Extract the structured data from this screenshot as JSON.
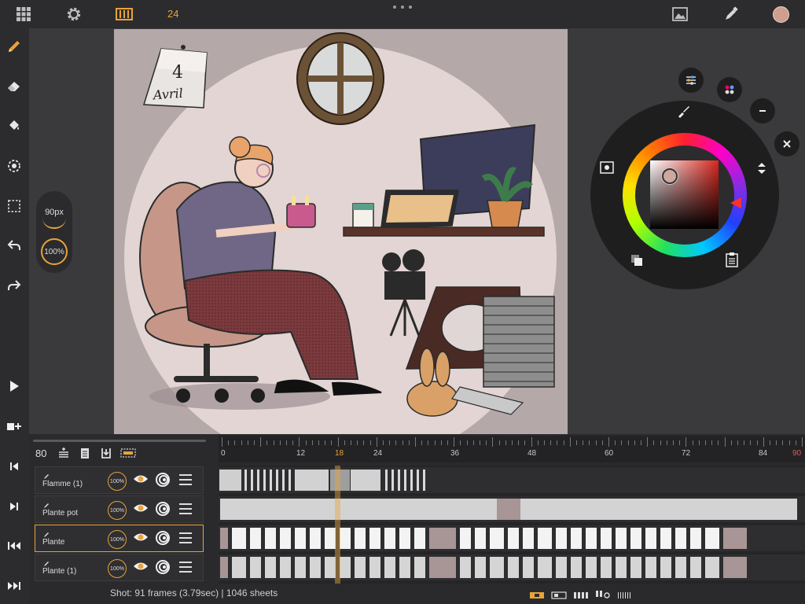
{
  "app": {
    "frame_rate": "24",
    "accent": "#e8a33b"
  },
  "topbar": {
    "icons": [
      "grid-icon",
      "settings-gear-icon",
      "film-strip-icon",
      "gallery-image-icon",
      "color-picker-pen-icon"
    ],
    "fps_label": "24",
    "avatar_color": "#cf9e8c"
  },
  "left_toolbar": {
    "tools": [
      "pencil-icon",
      "eraser-icon",
      "fill-bucket-icon",
      "lasso-transform-icon",
      "selection-rect-icon",
      "undo-icon",
      "redo-icon"
    ],
    "transport": [
      "play-icon",
      "add-frame-icon",
      "previous-frame-icon",
      "next-frame-icon",
      "first-frame-icon",
      "last-frame-icon"
    ]
  },
  "brush": {
    "size_label": "90px",
    "opacity_label": "100%"
  },
  "artwork": {
    "calendar_day": "4",
    "calendar_month": "Avril"
  },
  "color_picker": {
    "selected_color": "#cfa79c",
    "controls": [
      "sliders-icon",
      "palette-dots-icon",
      "minus-icon",
      "close-icon",
      "brush-icon",
      "eyedropper-icon",
      "swap-icon",
      "copy-icon",
      "paste-icon"
    ]
  },
  "timeline": {
    "frame_count": "80",
    "ruler_labels": [
      "0",
      "12",
      "18",
      "24",
      "36",
      "48",
      "60",
      "72",
      "84",
      "90"
    ],
    "current_frame": "18",
    "layers": [
      {
        "name": "Flamme (1)",
        "opacity": "100%",
        "selected": false
      },
      {
        "name": "Plante pot",
        "opacity": "100%",
        "selected": false
      },
      {
        "name": "Plante",
        "opacity": "100%",
        "selected": true
      },
      {
        "name": "Plante (1)",
        "opacity": "100%",
        "selected": false
      }
    ],
    "status": "Shot: 91 frames (3.79sec) | 1046 sheets"
  }
}
